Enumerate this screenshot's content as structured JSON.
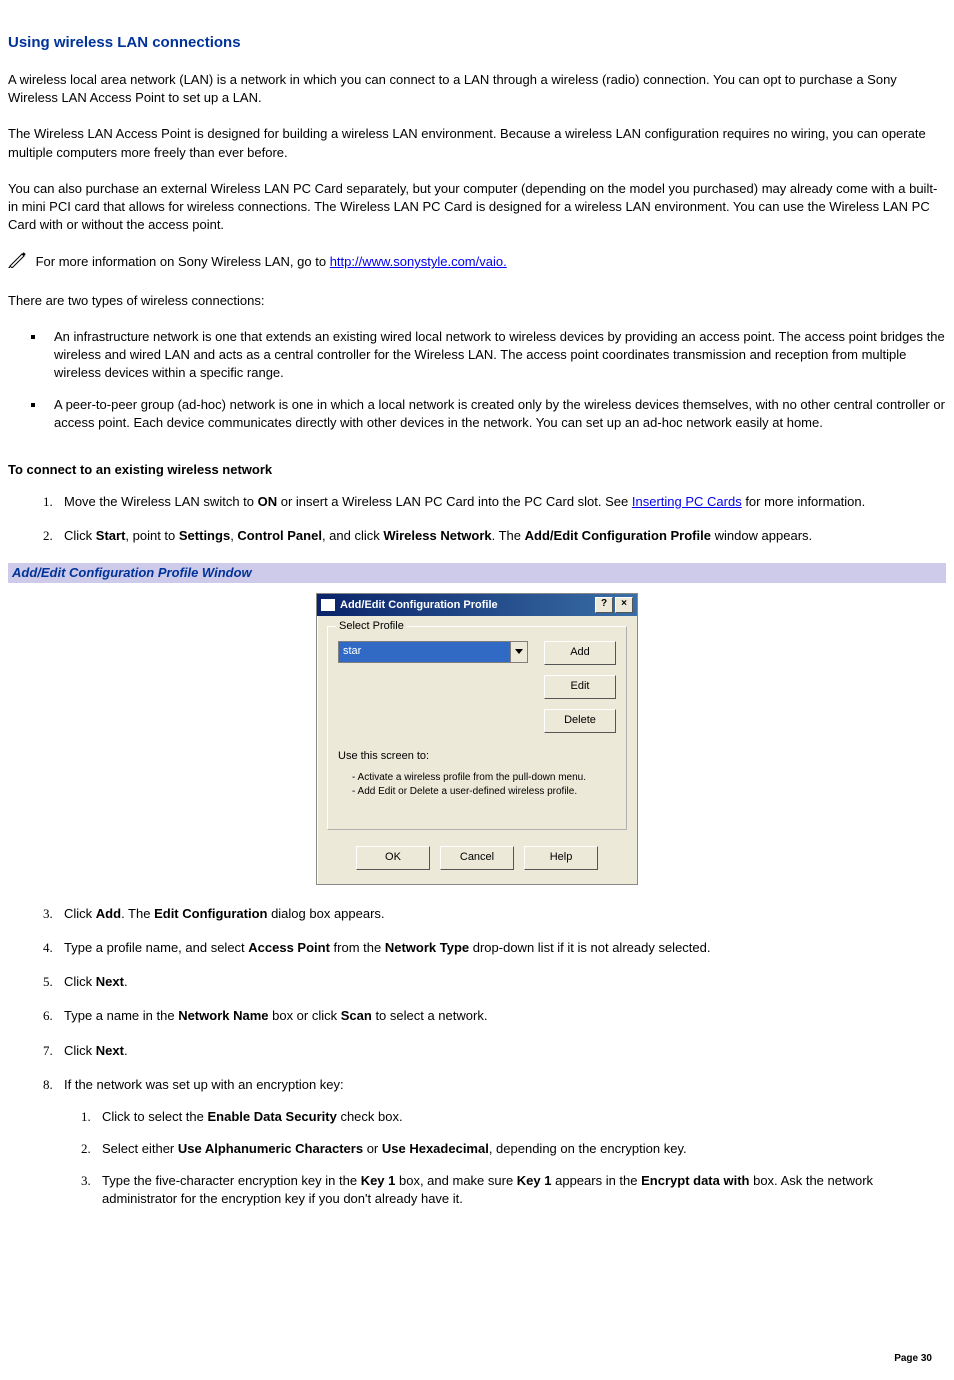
{
  "heading": "Using wireless LAN connections",
  "para1": "A wireless local area network (LAN) is a network in which you can connect to a LAN through a wireless (radio) connection. You can opt to purchase a Sony Wireless LAN Access Point to set up a LAN.",
  "para2": "The Wireless LAN Access Point is designed for building a wireless LAN environment. Because a wireless LAN configuration requires no wiring, you can operate multiple computers more freely than ever before.",
  "para3": "You can also purchase an external Wireless LAN PC Card separately, but your computer (depending on the model you purchased) may already come with a built-in mini PCI card that allows for wireless connections. The Wireless LAN PC Card is designed for a wireless LAN environment. You can use the Wireless LAN PC Card with or without the access point.",
  "note_prefix": " For more information on Sony Wireless LAN, go to ",
  "note_link": "http://www.sonystyle.com/vaio.",
  "para4": "There are two types of wireless connections:",
  "bullets": [
    "An infrastructure network is one that extends an existing wired local network to wireless devices by providing an access point. The access point bridges the wireless and wired LAN and acts as a central controller for the Wireless LAN. The access point coordinates transmission and reception from multiple wireless devices within a specific range.",
    "A peer-to-peer group (ad-hoc) network is one in which a local network is created only by the wireless devices themselves, with no other central controller or access point. Each device communicates directly with other devices in the network. You can set up an ad-hoc network easily at home."
  ],
  "subheading": "To connect to an existing wireless network",
  "step1_a": "Move the Wireless LAN switch to ",
  "step1_b_bold": "ON",
  "step1_c": " or insert a Wireless LAN PC Card into the PC Card slot. See ",
  "step1_link": "Inserting PC Cards",
  "step1_d": " for more information.",
  "step2_a": "Click ",
  "step2_b1": "Start",
  "step2_b2": ", point to ",
  "step2_b3": "Settings",
  "step2_b4": ", ",
  "step2_b5": "Control Panel",
  "step2_b6": ", and click ",
  "step2_b7": "Wireless Network",
  "step2_b8": ". The ",
  "step2_b9": "Add/Edit Configuration Profile",
  "step2_b10": " window appears.",
  "caption": "Add/Edit Configuration Profile Window",
  "dialog": {
    "title": "Add/Edit Configuration Profile",
    "help_btn": "?",
    "close_btn": "×",
    "group_title": "Select Profile",
    "selected": "star",
    "add": "Add",
    "edit": "Edit",
    "delete": "Delete",
    "use_label": "Use this screen to:",
    "use1": "- Activate a wireless profile from the pull-down menu.",
    "use2": "- Add Edit or Delete a user-defined wireless profile.",
    "ok": "OK",
    "cancel": "Cancel",
    "help": "Help"
  },
  "step3_a": "Click ",
  "step3_b1": "Add",
  "step3_b2": ". The ",
  "step3_b3": "Edit Configuration",
  "step3_b4": " dialog box appears.",
  "step4_a": "Type a profile name, and select ",
  "step4_b1": "Access Point",
  "step4_b2": " from the ",
  "step4_b3": "Network Type",
  "step4_b4": " drop-down list if it is not already selected.",
  "step5_a": "Click ",
  "step5_b": "Next",
  "step5_c": ".",
  "step6_a": "Type a name in the ",
  "step6_b1": "Network Name",
  "step6_b2": " box or click ",
  "step6_b3": "Scan",
  "step6_b4": " to select a network.",
  "step7_a": "Click ",
  "step7_b": "Next",
  "step7_c": ".",
  "step8": "If the network was set up with an encryption key:",
  "sub1_a": "Click to select the ",
  "sub1_b": "Enable Data Security",
  "sub1_c": " check box.",
  "sub2_a": "Select either ",
  "sub2_b1": "Use Alphanumeric Characters",
  "sub2_b2": " or ",
  "sub2_b3": "Use Hexadecimal",
  "sub2_b4": ", depending on the encryption key.",
  "sub3_a": "Type the five-character encryption key in the ",
  "sub3_b1": "Key 1",
  "sub3_b2": " box, and make sure ",
  "sub3_b3": "Key 1",
  "sub3_b4": " appears in the ",
  "sub3_b5": "Encrypt data with",
  "sub3_b6": " box. Ask the network administrator for the encryption key if you don't already have it.",
  "page": "Page 30"
}
